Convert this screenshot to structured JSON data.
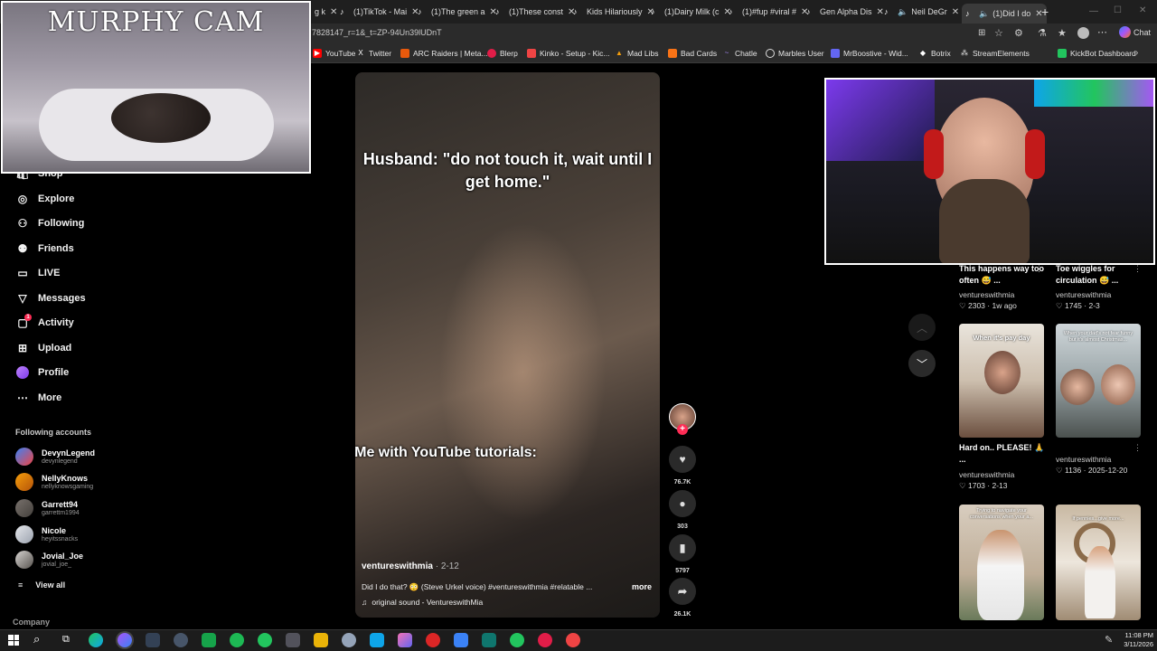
{
  "tabs": [
    {
      "label": "(1)TikTok - Mai"
    },
    {
      "label": "(1)The green a"
    },
    {
      "label": "(1)These const"
    },
    {
      "label": "Kids Hilariously"
    },
    {
      "label": "(1)Dairy Milk (c"
    },
    {
      "label": "(1)#fup #viral #"
    },
    {
      "label": "Gen Alpha Dis"
    },
    {
      "label": "Neil DeGr"
    },
    {
      "label": "(1)Did I do"
    }
  ],
  "browser": {
    "url": "7828147_r=1&_t=ZP-94Un39lUDnT",
    "chat_label": "Chat",
    "bookmarks": [
      "YouTube",
      "Twitter",
      "ARC Raiders | Meta...",
      "Blerp",
      "Kinko - Setup - Kic...",
      "Mad Libs",
      "Bad Cards",
      "Chatle",
      "Marbles User",
      "MrBoostive - Wid...",
      "Botrix",
      "StreamElements",
      "KickBot Dashboard"
    ]
  },
  "overlays": {
    "murphy_cam": "MURPHY CAM"
  },
  "sidebar": {
    "nav": [
      {
        "label": "Shop",
        "icon": "shop-icon"
      },
      {
        "label": "Explore",
        "icon": "compass-icon"
      },
      {
        "label": "Following",
        "icon": "following-icon"
      },
      {
        "label": "Friends",
        "icon": "friends-icon"
      },
      {
        "label": "LIVE",
        "icon": "live-icon"
      },
      {
        "label": "Messages",
        "icon": "messages-icon"
      },
      {
        "label": "Activity",
        "icon": "activity-icon"
      },
      {
        "label": "Upload",
        "icon": "upload-icon"
      },
      {
        "label": "Profile",
        "icon": "profile-icon"
      },
      {
        "label": "More",
        "icon": "more-icon"
      }
    ],
    "following_title": "Following accounts",
    "accounts": [
      {
        "name": "DevynLegend",
        "handle": "devynlegend"
      },
      {
        "name": "NellyKnows",
        "handle": "nellyknowsgaming"
      },
      {
        "name": "Garrett94",
        "handle": "garrettm1994"
      },
      {
        "name": "Nicole",
        "handle": "heyitssnacks"
      },
      {
        "name": "Jovial_Joe",
        "handle": "jovial_joe_"
      }
    ],
    "view_all": "View all",
    "company": "Company"
  },
  "video": {
    "caption_top": "Husband: \"do not touch it, wait until I get home.\"",
    "caption_mid": "Me with YouTube tutorials:",
    "author": "ventureswithmia",
    "date": "2-12",
    "description": "Did I do that? 😳 (Steve Urkel voice) #ventureswithmia #relatable ...",
    "more": "more",
    "sound": "original sound - VentureswithMia"
  },
  "actions": {
    "likes": "76.7K",
    "comments": "303",
    "saves": "5797",
    "shares": "26.1K"
  },
  "recommended": [
    {
      "title": "This happens way too often 😅 ...",
      "user": "ventureswithmia",
      "likes": "2303",
      "date": "1w ago"
    },
    {
      "title": "Toe wiggles for circulation 😅 ...",
      "user": "ventureswithmia",
      "likes": "1745",
      "date": "2-3"
    },
    {
      "title": "Hard on.. PLEASE! 🙏 ...",
      "user": "ventureswithmia",
      "likes": "1703",
      "date": "2-13",
      "thumb_text": "When it's pay day"
    },
    {
      "title": "",
      "user": "ventureswithmia",
      "likes": "1136",
      "date": "2025-12-20",
      "thumb_text": "When your dad's not fear funny but it's almost Christmas..."
    },
    {
      "title": "",
      "user": "",
      "likes": "",
      "date": "",
      "thumb_text": "Trying to navigate your conversations when your a..."
    },
    {
      "title": "",
      "user": "",
      "likes": "",
      "date": "",
      "thumb_text": "If pennies...give more..."
    }
  ],
  "taskbar": {
    "time": "11:08 PM",
    "date": "3/11/2026"
  },
  "colors": {
    "tiktok_red": "#fe2c55",
    "background": "#000000",
    "chrome": "#1f1f1f"
  }
}
